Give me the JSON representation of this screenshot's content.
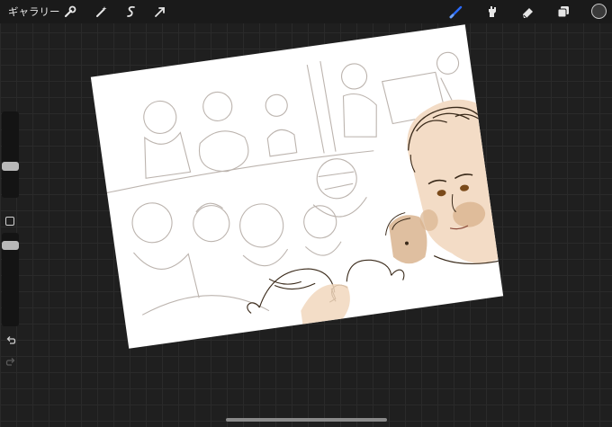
{
  "topbar": {
    "gallery_label": "ギャラリー",
    "icons": [
      "wrench-icon",
      "magic-wand-icon",
      "selection-icon",
      "transform-arrow-icon",
      "brush-icon",
      "smudge-icon",
      "eraser-icon",
      "layers-icon"
    ],
    "active_color": "#2a6bff",
    "current_color": "#3a3a3a"
  },
  "canvas": {
    "background": "#ffffff",
    "sketch_color": "#b5aca6",
    "ink_color": "#3a2a1a",
    "skin_color": "#d9b48f"
  }
}
